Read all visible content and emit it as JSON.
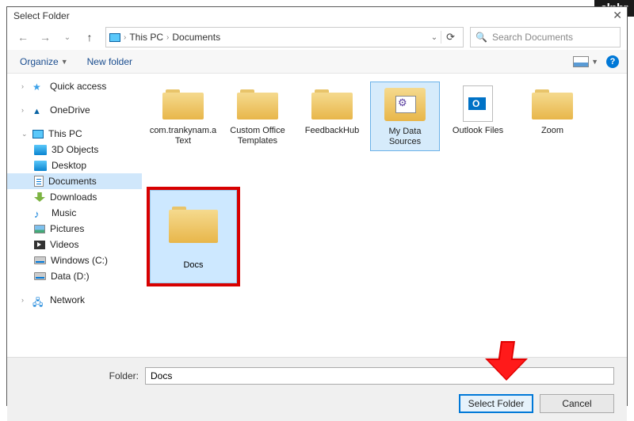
{
  "brand": "alphr",
  "title": "Select Folder",
  "breadcrumb": {
    "root": "This PC",
    "current": "Documents"
  },
  "search": {
    "placeholder": "Search Documents"
  },
  "toolbar": {
    "organize": "Organize",
    "newfolder": "New folder"
  },
  "sidebar": {
    "quick": "Quick access",
    "onedrive": "OneDrive",
    "thispc": "This PC",
    "items": [
      "3D Objects",
      "Desktop",
      "Documents",
      "Downloads",
      "Music",
      "Pictures",
      "Videos",
      "Windows (C:)",
      "Data (D:)"
    ],
    "network": "Network"
  },
  "folders": [
    {
      "name": "com.trankynam.aText"
    },
    {
      "name": "Custom Office Templates"
    },
    {
      "name": "FeedbackHub"
    },
    {
      "name": "My Data Sources"
    },
    {
      "name": "Outlook Files"
    },
    {
      "name": "Zoom"
    }
  ],
  "selected_folder": "Docs",
  "footer": {
    "label": "Folder:",
    "value": "Docs",
    "select": "Select Folder",
    "cancel": "Cancel"
  }
}
